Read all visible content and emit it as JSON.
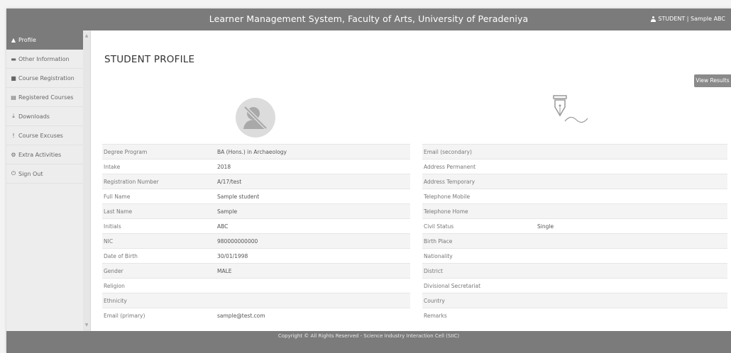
{
  "header": {
    "title": "Learner Management System, Faculty of Arts, University of Peradeniya",
    "user_label": "STUDENT  |  Sample ABC"
  },
  "sidebar": {
    "items": [
      {
        "label": "Profile",
        "icon": "user-icon",
        "glyph": "▲"
      },
      {
        "label": "Other Information",
        "icon": "folder-icon",
        "glyph": "▬"
      },
      {
        "label": "Course Registration",
        "icon": "book-icon",
        "glyph": "■"
      },
      {
        "label": "Registered Courses",
        "icon": "document-icon",
        "glyph": "▤"
      },
      {
        "label": "Downloads",
        "icon": "download-icon",
        "glyph": "⤓"
      },
      {
        "label": "Course Excuses",
        "icon": "exclamation-icon",
        "glyph": "!"
      },
      {
        "label": "Extra Activities",
        "icon": "gear-icon",
        "glyph": "⚙"
      },
      {
        "label": "Sign Out",
        "icon": "power-icon",
        "glyph": "⏻"
      }
    ]
  },
  "main": {
    "title": "STUDENT PROFILE",
    "view_results": "View Results"
  },
  "profile_left": [
    {
      "label": "Degree Program",
      "value": "BA (Hons.) in Archaeology"
    },
    {
      "label": "Intake",
      "value": "2018"
    },
    {
      "label": "Registration Number",
      "value": "A/17/test"
    },
    {
      "label": "Full Name",
      "value": "Sample student"
    },
    {
      "label": "Last Name",
      "value": "Sample"
    },
    {
      "label": "Initials",
      "value": "ABC"
    },
    {
      "label": "NIC",
      "value": "980000000000"
    },
    {
      "label": "Date of Birth",
      "value": "30/01/1998"
    },
    {
      "label": "Gender",
      "value": "MALE"
    },
    {
      "label": "Religion",
      "value": ""
    },
    {
      "label": "Ethnicity",
      "value": ""
    },
    {
      "label": "Email (primary)",
      "value": "sample@test.com"
    }
  ],
  "profile_right": [
    {
      "label": "Email (secondary)",
      "value": ""
    },
    {
      "label": "Address Permanent",
      "value": ""
    },
    {
      "label": "Address Temporary",
      "value": ""
    },
    {
      "label": "Telephone Mobile",
      "value": ""
    },
    {
      "label": "Telephone Home",
      "value": ""
    },
    {
      "label": "Civil Status",
      "value": "Single"
    },
    {
      "label": "Birth Place",
      "value": ""
    },
    {
      "label": "Nationality",
      "value": ""
    },
    {
      "label": "District",
      "value": ""
    },
    {
      "label": "Divisional Secretariat",
      "value": ""
    },
    {
      "label": "Country",
      "value": ""
    },
    {
      "label": "Remarks",
      "value": ""
    }
  ],
  "footer": {
    "text": "Copyright © All Rights Reserved - Science Industry Interaction Cell (SIIC)"
  },
  "colors": {
    "bar": "#7b7b7b",
    "sidebar_bg": "#ededed",
    "active_item": "#7b7b7b"
  }
}
